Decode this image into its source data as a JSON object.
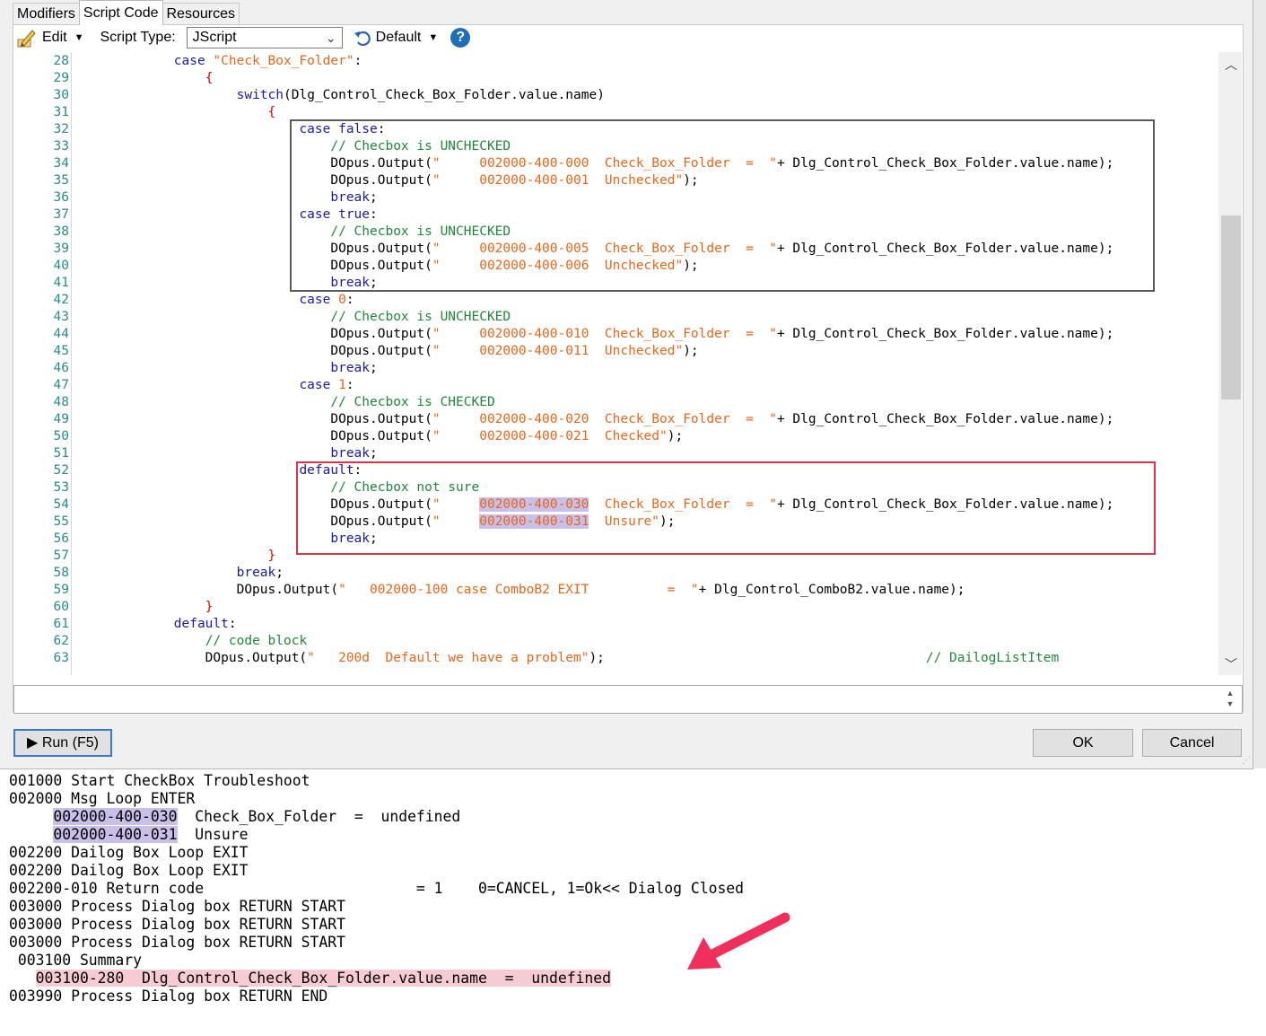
{
  "tabs": [
    "Modifiers",
    "Script Code",
    "Resources"
  ],
  "toolbar": {
    "edit_label": "Edit",
    "script_type_label": "Script Type:",
    "script_type_value": "JScript",
    "default_label": "Default",
    "help_glyph": "?"
  },
  "editor": {
    "lines": [
      {
        "n": "28",
        "html": "            <span class=\"k\">case</span> <span class=\"s\">\"Check_Box_Folder\"</span>:"
      },
      {
        "n": "29",
        "html": "                <span class=\"p\">{</span>"
      },
      {
        "n": "30",
        "html": "                    <span class=\"k\">switch</span>(Dlg_Control_Check_Box_Folder.value.name)"
      },
      {
        "n": "31",
        "html": "                        <span class=\"p\">{</span>"
      },
      {
        "n": "32",
        "html": "                            <span class=\"k\">case false</span>:"
      },
      {
        "n": "33",
        "html": "                                <span class=\"c\">// Checbox is UNCHECKED</span>"
      },
      {
        "n": "34",
        "html": "                                DOpus.Output(<span class=\"s\">\"     002000-400-000  Check_Box_Folder  =  \"</span>+ Dlg_Control_Check_Box_Folder.value.name);"
      },
      {
        "n": "35",
        "html": "                                DOpus.Output(<span class=\"s\">\"     002000-400-001  Unchecked\"</span>);"
      },
      {
        "n": "36",
        "html": "                                <span class=\"k\">break</span>;"
      },
      {
        "n": "37",
        "html": "                            <span class=\"k\">case true</span>:"
      },
      {
        "n": "38",
        "html": "                                <span class=\"c\">// Checbox is UNCHECKED</span>"
      },
      {
        "n": "39",
        "html": "                                DOpus.Output(<span class=\"s\">\"     002000-400-005  Check_Box_Folder  =  \"</span>+ Dlg_Control_Check_Box_Folder.value.name);"
      },
      {
        "n": "40",
        "html": "                                DOpus.Output(<span class=\"s\">\"     002000-400-006  Unchecked\"</span>);"
      },
      {
        "n": "41",
        "html": "                                <span class=\"k\">break</span>;"
      },
      {
        "n": "42",
        "html": "                            <span class=\"k\">case</span> <span class=\"s\">0</span>:"
      },
      {
        "n": "43",
        "html": "                                <span class=\"c\">// Checbox is UNCHECKED</span>"
      },
      {
        "n": "44",
        "html": "                                DOpus.Output(<span class=\"s\">\"     002000-400-010  Check_Box_Folder  =  \"</span>+ Dlg_Control_Check_Box_Folder.value.name);"
      },
      {
        "n": "45",
        "html": "                                DOpus.Output(<span class=\"s\">\"     002000-400-011  Unchecked\"</span>);"
      },
      {
        "n": "46",
        "html": "                                <span class=\"k\">break</span>;"
      },
      {
        "n": "47",
        "html": "                            <span class=\"k\">case</span> <span class=\"s\">1</span>:"
      },
      {
        "n": "48",
        "html": "                                <span class=\"c\">// Checbox is CHECKED</span>"
      },
      {
        "n": "49",
        "html": "                                DOpus.Output(<span class=\"s\">\"     002000-400-020  Check_Box_Folder  =  \"</span>+ Dlg_Control_Check_Box_Folder.value.name);"
      },
      {
        "n": "50",
        "html": "                                DOpus.Output(<span class=\"s\">\"     002000-400-021  Checked\"</span>);"
      },
      {
        "n": "51",
        "html": "                                <span class=\"k\">break</span>;"
      },
      {
        "n": "52",
        "html": "                            <span class=\"k\">default</span>:"
      },
      {
        "n": "53",
        "html": "                                <span class=\"c\">// Checbox not sure</span>"
      },
      {
        "n": "54",
        "html": "                                DOpus.Output(<span class=\"s\">\"     <span class=\"hl\">002000-400-030</span>  Check_Box_Folder  =  \"</span>+ Dlg_Control_Check_Box_Folder.value.name);"
      },
      {
        "n": "55",
        "html": "                                DOpus.Output(<span class=\"s\">\"     <span class=\"hl\">002000-400-031</span>  Unsure\"</span>);"
      },
      {
        "n": "56",
        "html": "                                <span class=\"k\">break</span>;"
      },
      {
        "n": "57",
        "html": "                        <span class=\"p\">}</span>"
      },
      {
        "n": "58",
        "html": "                    <span class=\"k\">break</span>;"
      },
      {
        "n": "59",
        "html": "                    DOpus.Output(<span class=\"s\">\"   002000-100 case ComboB2 EXIT          =  \"</span>+ Dlg_Control_ComboB2.value.name);"
      },
      {
        "n": "60",
        "html": "                <span class=\"p\">}</span>"
      },
      {
        "n": "61",
        "html": "            <span class=\"k\">default</span>:"
      },
      {
        "n": "62",
        "html": "                <span class=\"c\">// code block</span>"
      },
      {
        "n": "63",
        "html": "                DOpus.Output(<span class=\"s\">\"   200d  Default we have a problem\"</span>);                                         <span class=\"c\">// DailogListItem</span>"
      }
    ]
  },
  "buttons": {
    "run": "Run (F5)",
    "ok": "OK",
    "cancel": "Cancel"
  },
  "log": [
    {
      "html": "001000 Start CheckBox Troubleshoot"
    },
    {
      "html": "002000 Msg Loop ENTER"
    },
    {
      "html": "     <span class=\"hl2\">002000-400-030</span>  Check_Box_Folder  =  undefined"
    },
    {
      "html": "     <span class=\"hl2\">002000-400-031</span>  Unsure"
    },
    {
      "html": "002200 Dailog Box Loop EXIT"
    },
    {
      "html": "002200 Dailog Box Loop EXIT"
    },
    {
      "html": "002200-010 Return code                        = 1    0=CANCEL, 1=Ok<< Dialog Closed"
    },
    {
      "html": "003000 Process Dialog box RETURN START"
    },
    {
      "html": "003000 Process Dialog box RETURN START"
    },
    {
      "html": "003000 Process Dialog box RETURN START"
    },
    {
      "html": " 003100 Summary"
    },
    {
      "html": "   <span class=\"pink\">003100-280  Dlg_Control_Check_Box_Folder.value.name  =  undefined</span>"
    },
    {
      "html": "003990 Process Dialog box RETURN END"
    }
  ],
  "colors": {
    "annotation_arrow": "#f0305a",
    "highlight_box_dark": "#5a5a5a",
    "highlight_box_red": "#e0314b"
  }
}
